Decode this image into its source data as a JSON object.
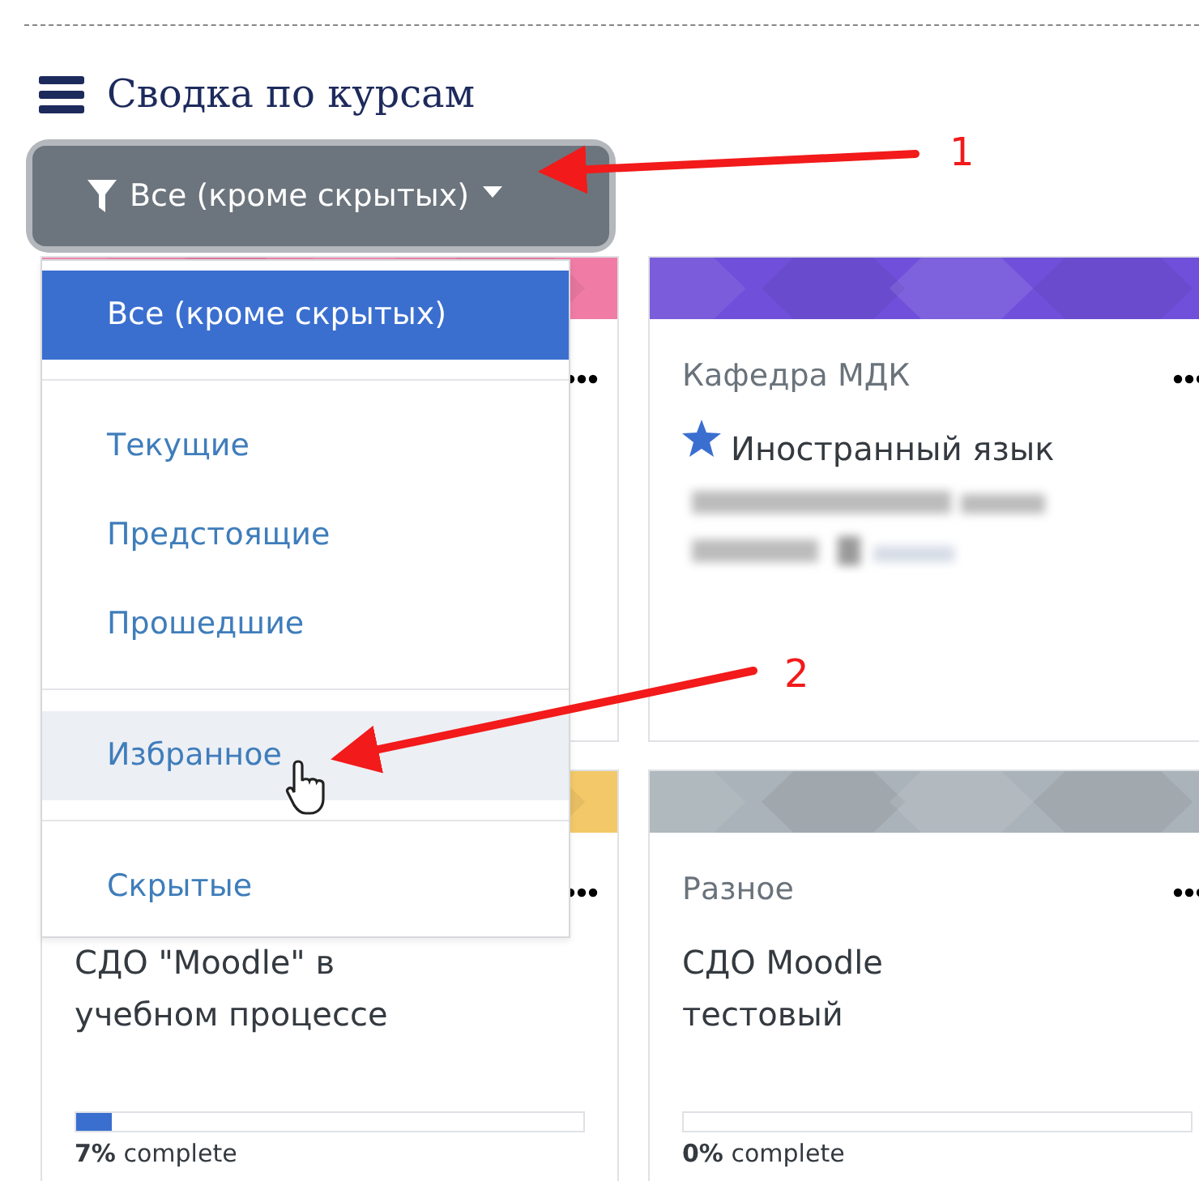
{
  "header": {
    "title": "Сводка по курсам"
  },
  "filter_button": {
    "label": "Все (кроме скрытых)",
    "expanded": true
  },
  "filter_menu": {
    "groups": [
      [
        {
          "label": "Все (кроме скрытых)",
          "selected": true,
          "hovered": false
        }
      ],
      [
        {
          "label": "Текущие",
          "selected": false,
          "hovered": false
        },
        {
          "label": "Предстоящие",
          "selected": false,
          "hovered": false
        },
        {
          "label": "Прошедшие",
          "selected": false,
          "hovered": false
        }
      ],
      [
        {
          "label": "Избранное",
          "selected": false,
          "hovered": true
        }
      ],
      [
        {
          "label": "Скрытые",
          "selected": false,
          "hovered": false
        }
      ]
    ]
  },
  "courses": [
    {
      "color": "#f07ca6"
    },
    {
      "color": "#7050da",
      "category": "Кафедра МДК",
      "title": "Иностранный язык",
      "starred": true,
      "blurred": true
    },
    {
      "color": "#f3c868",
      "title": "СДО \"Moodle\" в\nучебном процессе",
      "starred": false,
      "progress": {
        "level": 0.07,
        "label": "**7%** complete"
      }
    },
    {
      "color": "#aab3b9",
      "category": "Разное",
      "title": "СДО Moodle\nтестовый",
      "starred": false,
      "progress": {
        "level": 0,
        "label": "**0%** complete"
      }
    }
  ],
  "annotations": [
    {
      "label": "1"
    },
    {
      "label": "2"
    }
  ]
}
